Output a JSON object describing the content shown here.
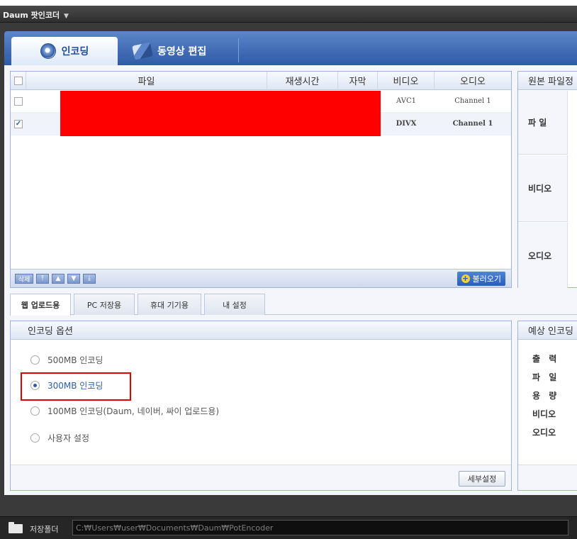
{
  "window": {
    "title": "Daum 팟인코더",
    "caret": "▼"
  },
  "top_tabs": [
    {
      "label": "인코딩",
      "icon": "disc-icon",
      "active": true
    },
    {
      "label": "동영상 편집",
      "icon": "film-reel-icon",
      "active": false
    }
  ],
  "file_list": {
    "columns": [
      "파일",
      "재생시간",
      "자막",
      "비디오",
      "오디오"
    ],
    "rows": [
      {
        "checked": false,
        "video": "AVC1",
        "audio": "Channel 1"
      },
      {
        "checked": true,
        "video": "DIVX",
        "audio": "Channel 1"
      }
    ],
    "footer": {
      "delete_label": "삭제",
      "load_label": "불러오기"
    }
  },
  "source_info": {
    "title": "원본 파일정",
    "labels": [
      "파 일",
      "비디오",
      "오디오"
    ]
  },
  "sub_tabs": [
    {
      "label": "웹 업로드용",
      "active": true
    },
    {
      "label": "PC 저장용",
      "active": false
    },
    {
      "label": "휴대 기기용",
      "active": false
    },
    {
      "label": "내 설정",
      "active": false
    }
  ],
  "encoding_options": {
    "title": "인코딩 옵션",
    "options": [
      {
        "label": "500MB 인코딩",
        "selected": false
      },
      {
        "label": "300MB 인코딩",
        "selected": true
      },
      {
        "label": "100MB 인코딩(Daum, 네이버, 싸이 업로드용)",
        "selected": false
      },
      {
        "label": "사용자 설정",
        "selected": false
      }
    ],
    "detail_button": "세부설정"
  },
  "expected": {
    "title": "예상 인코딩",
    "labels": [
      "출 력",
      "파 일",
      "용 량",
      "비디오",
      "오디오"
    ]
  },
  "status": {
    "folder_label": "저장폴더",
    "path": "C:₩Users₩user₩Documents₩Daum₩PotEncoder"
  },
  "colors": {
    "accent": "#2a5db0",
    "highlight": "#e00000",
    "redaction": "#ff0000"
  }
}
